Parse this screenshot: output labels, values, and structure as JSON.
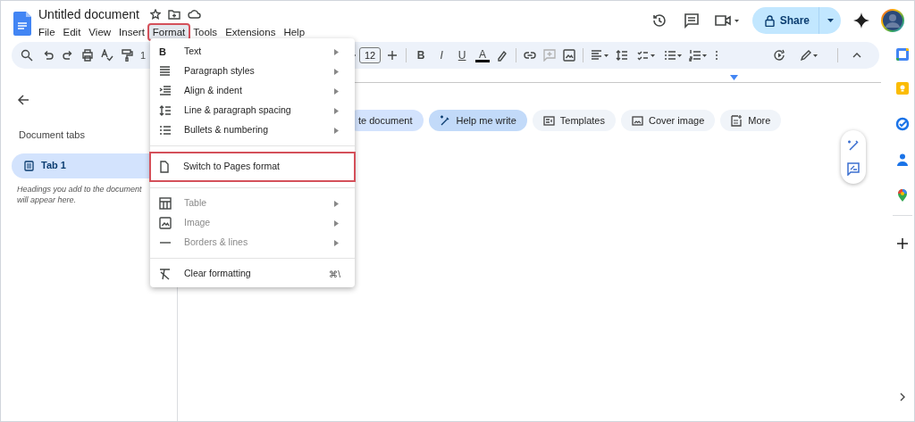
{
  "document": {
    "title": "Untitled document"
  },
  "menubar": [
    {
      "label": "File",
      "selected": false,
      "highlighted": false
    },
    {
      "label": "Edit",
      "selected": false,
      "highlighted": false
    },
    {
      "label": "View",
      "selected": false,
      "highlighted": false
    },
    {
      "label": "Insert",
      "selected": false,
      "highlighted": false
    },
    {
      "label": "Format",
      "selected": true,
      "highlighted": true
    },
    {
      "label": "Tools",
      "selected": false,
      "highlighted": false
    },
    {
      "label": "Extensions",
      "selected": false,
      "highlighted": false
    },
    {
      "label": "Help",
      "selected": false,
      "highlighted": false
    }
  ],
  "share": {
    "label": "Share"
  },
  "toolbar": {
    "zoom": "1",
    "font_size": "12",
    "styles": [
      "B",
      "I",
      "U",
      "A"
    ]
  },
  "sidebar": {
    "heading": "Document tabs",
    "tabs": [
      {
        "label": "Tab 1",
        "selected": true
      }
    ],
    "hint": "Headings you add to the document will appear here."
  },
  "chips": [
    {
      "label": "te document",
      "kind": "tinted"
    },
    {
      "label": "Help me write",
      "kind": "accent"
    },
    {
      "label": "Templates",
      "kind": "plain"
    },
    {
      "label": "Cover image",
      "kind": "plain"
    },
    {
      "label": "More",
      "kind": "plain"
    }
  ],
  "format_menu": {
    "sections": [
      [
        {
          "label": "Text",
          "glyph": "B",
          "submenu": true,
          "disabled": false,
          "highlighted": false
        },
        {
          "label": "Paragraph styles",
          "submenu": true,
          "disabled": false,
          "highlighted": false
        },
        {
          "label": "Align & indent",
          "submenu": true,
          "disabled": false,
          "highlighted": false
        },
        {
          "label": "Line & paragraph spacing",
          "submenu": true,
          "disabled": false,
          "highlighted": false
        },
        {
          "label": "Bullets & numbering",
          "submenu": true,
          "disabled": false,
          "highlighted": false
        }
      ],
      [
        {
          "label": "Switch to Pages format",
          "submenu": false,
          "disabled": false,
          "highlighted": true
        }
      ],
      [
        {
          "label": "Table",
          "submenu": true,
          "disabled": true,
          "highlighted": false
        },
        {
          "label": "Image",
          "submenu": true,
          "disabled": true,
          "highlighted": false
        },
        {
          "label": "Borders & lines",
          "submenu": true,
          "disabled": true,
          "highlighted": false
        }
      ],
      [
        {
          "label": "Clear formatting",
          "shortcut": "⌘\\",
          "submenu": false,
          "disabled": false,
          "highlighted": false
        }
      ]
    ]
  }
}
